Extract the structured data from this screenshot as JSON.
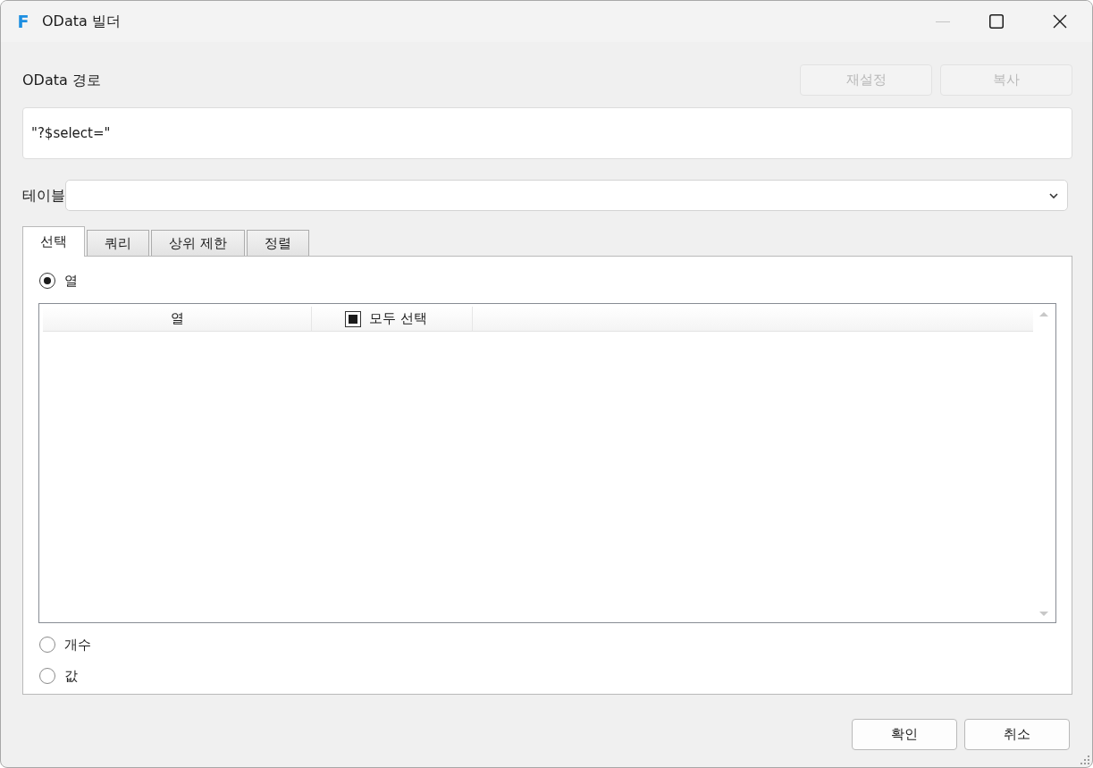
{
  "window": {
    "logo_letter": "F",
    "title": "OData 빌더",
    "minimize_disabled": true
  },
  "odata_path": {
    "label": "OData 경로",
    "value": "\"?$select=\""
  },
  "path_buttons": [
    {
      "label": "재설정",
      "disabled": true
    },
    {
      "label": "복사",
      "disabled": true
    }
  ],
  "table_select": {
    "label": "테이블"
  },
  "tabs": [
    {
      "label": "선택",
      "selected": true
    },
    {
      "label": "쿼리",
      "selected": false
    },
    {
      "label": "상위 제한",
      "selected": false
    },
    {
      "label": "정렬",
      "selected": false
    }
  ],
  "select_tab": {
    "options": [
      {
        "label": "열",
        "selected": true
      },
      {
        "label": "개수",
        "selected": false
      },
      {
        "label": "값",
        "selected": false
      }
    ],
    "column_grid": {
      "columns": [
        {
          "kind": "text",
          "label": "열"
        },
        {
          "kind": "checkbox",
          "label": "모두 선택",
          "checked": false,
          "indeterminate": true
        }
      ]
    }
  },
  "dialog_buttons": [
    {
      "label": "확인",
      "disabled": false
    },
    {
      "label": "취소",
      "disabled": false
    }
  ]
}
